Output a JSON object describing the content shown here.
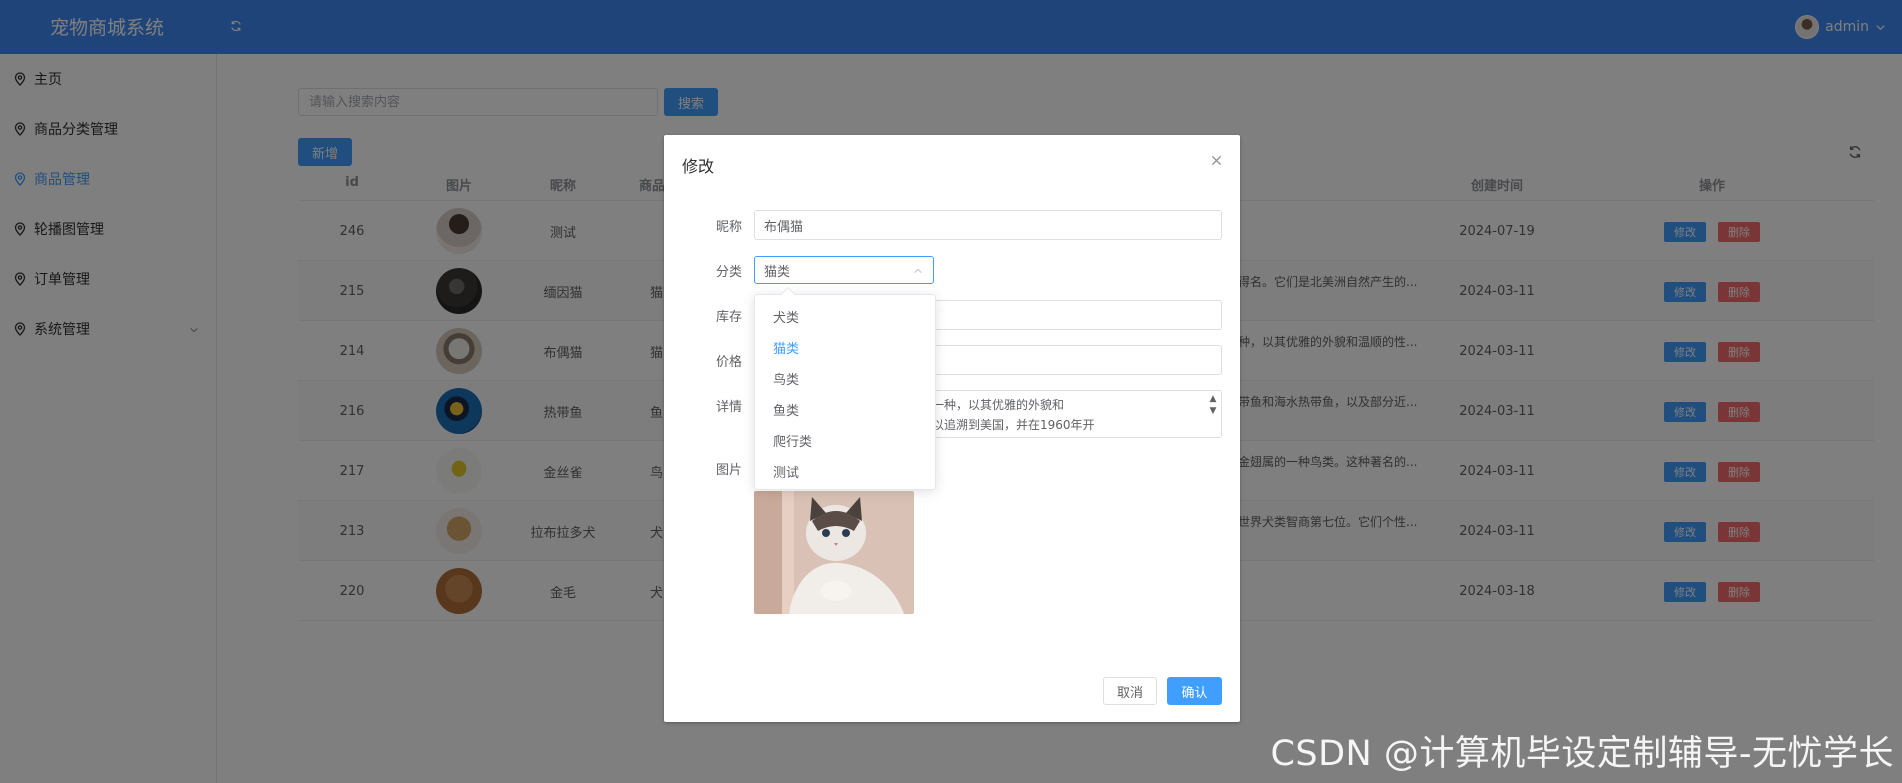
{
  "header": {
    "title": "宠物商城系统",
    "username": "admin"
  },
  "sidebar": {
    "items": [
      {
        "label": "主页"
      },
      {
        "label": "商品分类管理"
      },
      {
        "label": "商品管理"
      },
      {
        "label": "轮播图管理"
      },
      {
        "label": "订单管理"
      },
      {
        "label": "系统管理"
      }
    ],
    "active_index": 2
  },
  "search": {
    "placeholder": "请输入搜索内容",
    "button": "搜索"
  },
  "toolbar": {
    "add_label": "新增"
  },
  "table": {
    "headers": {
      "id": "id",
      "image": "图片",
      "nickname": "昵称",
      "category": "商品",
      "created": "创建时间",
      "actions": "操作"
    },
    "rows": [
      {
        "id": "246",
        "nickname": "测试",
        "category": "",
        "detail": "",
        "created": "2024-07-19"
      },
      {
        "id": "215",
        "nickname": "缅因猫",
        "category": "猫",
        "detail": "得名。它们是北美洲自然产生的...",
        "created": "2024-03-11"
      },
      {
        "id": "214",
        "nickname": "布偶猫",
        "category": "猫",
        "detail": "种，以其优雅的外貌和温顺的性...",
        "created": "2024-03-11"
      },
      {
        "id": "216",
        "nickname": "热带鱼",
        "category": "鱼",
        "detail": "带鱼和海水热带鱼，以及部分近...",
        "created": "2024-03-11"
      },
      {
        "id": "217",
        "nickname": "金丝雀",
        "category": "鸟",
        "detail": "金翅属的一种鸟类。这种著名的...",
        "created": "2024-03-11"
      },
      {
        "id": "213",
        "nickname": "拉布拉多犬",
        "category": "犬",
        "detail": "世界犬类智商第七位。它们个性...",
        "created": "2024-03-11"
      },
      {
        "id": "220",
        "nickname": "金毛",
        "category": "犬",
        "detail": "",
        "created": "2024-03-18"
      }
    ],
    "edit_label": "修改",
    "delete_label": "删除"
  },
  "dialog": {
    "title": "修改",
    "labels": {
      "nickname": "昵称",
      "category": "分类",
      "stock": "库存",
      "price": "价格",
      "detail": "详情",
      "image": "图片"
    },
    "nickname_value": "布偶猫",
    "category_value": "猫类",
    "detail_line1": "布偶猫是猫中体形和体重较大的一种，以其优雅的外貌和",
    "detail_line2": "温顺的性格著称。它们的起源可以追溯到美国，并在1960年开",
    "cancel_label": "取消",
    "confirm_label": "确认"
  },
  "dropdown": {
    "options": [
      "犬类",
      "猫类",
      "鸟类",
      "鱼类",
      "爬行类",
      "测试"
    ],
    "selected_index": 1
  },
  "watermark": "CSDN @计算机毕设定制辅导-无忧学长",
  "colors": {
    "header": "#3f88f5",
    "primary": "#409eff",
    "danger": "#f56c6c"
  }
}
